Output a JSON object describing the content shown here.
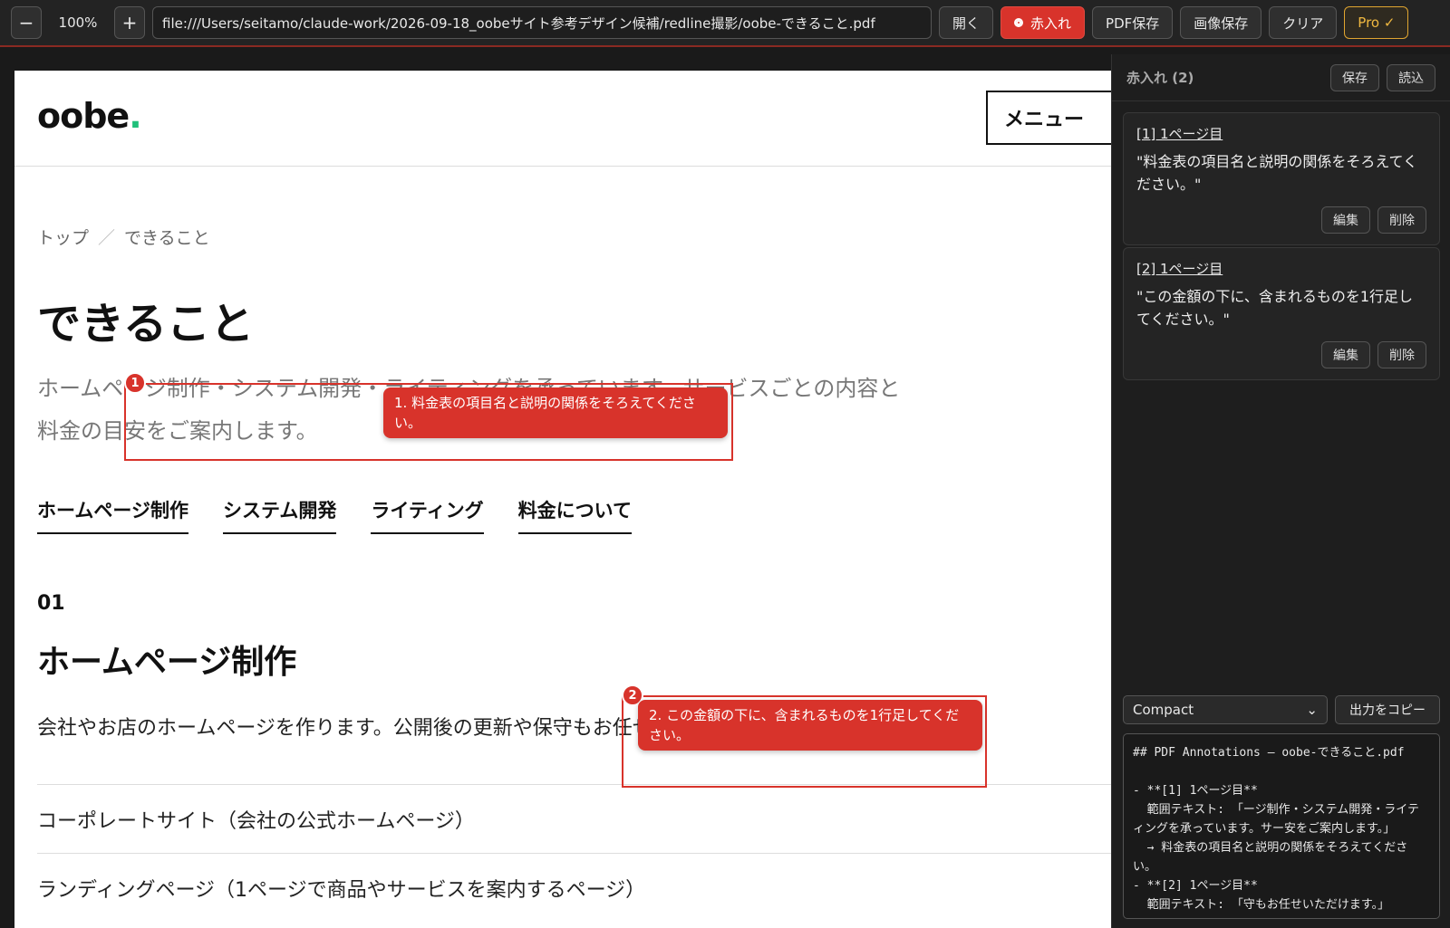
{
  "toolbar": {
    "zoom_out": "−",
    "zoom_level": "100%",
    "zoom_in": "+",
    "url": "file:///Users/seitamo/claude-work/2026-09-18_oobeサイト参考デザイン候補/redline撮影/oobe-できること.pdf",
    "open": "開く",
    "redline": "赤入れ",
    "pdf_save": "PDF保存",
    "image_save": "画像保存",
    "clear": "クリア",
    "pro": "Pro ✓"
  },
  "page": {
    "logo": "oobe",
    "logo_dot": ".",
    "menu": "メニュー",
    "breadcrumb": {
      "home": "トップ",
      "sep": "／",
      "current": "できること"
    },
    "title": "できること",
    "lead_line1": "ホームページ制作・システム開発・ライティングを承っています。サービスごとの内容と",
    "lead_line2": "料金の目安をご案内します。",
    "tabs": [
      "ホームページ制作",
      "システム開発",
      "ライティング",
      "料金について"
    ],
    "section_num": "01",
    "section_title": "ホームページ制作",
    "section_desc": "会社やお店のホームページを作ります。公開後の更新や保守もお任せいただけます。",
    "list": [
      "コーポレートサイト（会社の公式ホームページ）",
      "ランディングページ（1ページで商品やサービスを案内するページ）"
    ]
  },
  "annotations": [
    {
      "num": "1",
      "text": "1. 料金表の項目名と説明の関係をそろえてください。"
    },
    {
      "num": "2",
      "text": "2. この金額の下に、含まれるものを1行足してください。"
    }
  ],
  "sidebar": {
    "title": "赤入れ (2)",
    "save": "保存",
    "load": "読込",
    "cards": [
      {
        "head": "[1] 1ページ目",
        "text": "\"料金表の項目名と説明の関係をそろえてください。\"",
        "edit": "編集",
        "delete": "削除"
      },
      {
        "head": "[2] 1ページ目",
        "text": "\"この金額の下に、含まれるものを1行足してください。\"",
        "edit": "編集",
        "delete": "削除"
      }
    ],
    "format": "Compact",
    "copy": "出力をコピー",
    "output": "## PDF Annotations — oobe-できること.pdf\n\n- **[1] 1ページ目**\n  範囲テキスト: 「ージ制作・システム開発・ライティングを承っています。サー安をご案内します。」\n  → 料金表の項目名と説明の関係をそろえてください。\n- **[2] 1ページ目**\n  範囲テキスト: 「守もお任せいただけます。」"
  },
  "colors": {
    "accent_red": "#d8332b",
    "pro_gold": "#f0b840",
    "logo_dot": "#1fc07a"
  }
}
